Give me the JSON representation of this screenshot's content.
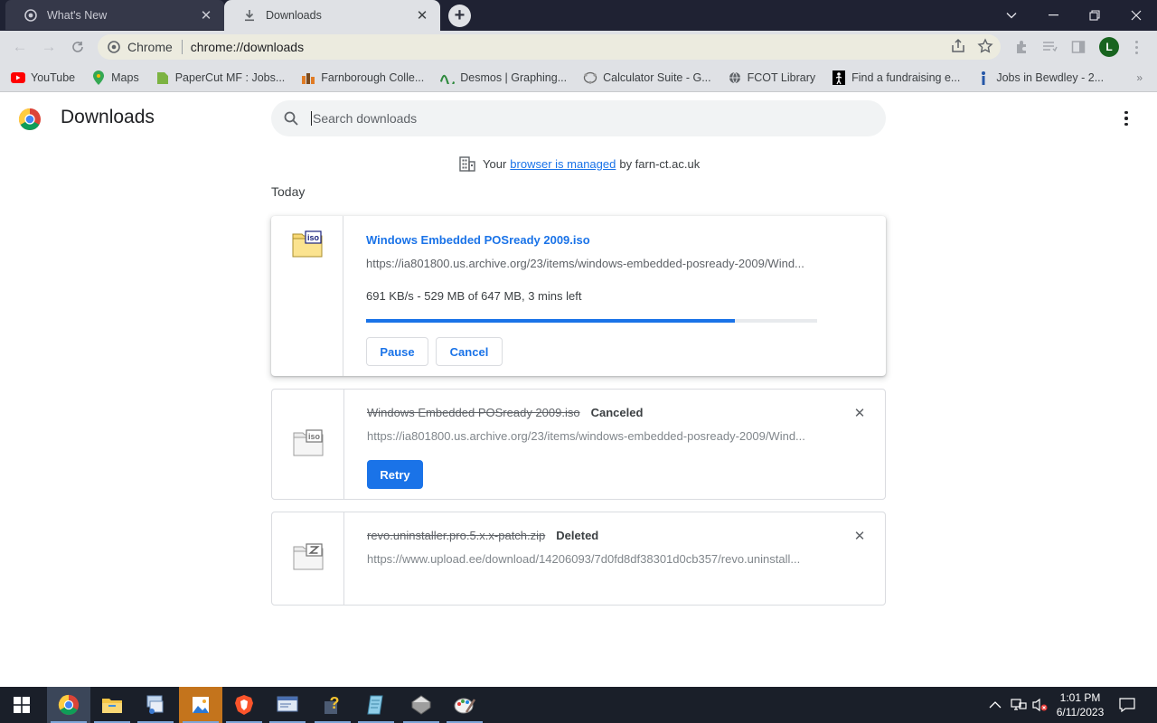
{
  "tabs": [
    {
      "title": "What's New",
      "icon": "chrome-settings-icon",
      "active": false
    },
    {
      "title": "Downloads",
      "icon": "download-icon",
      "active": true
    }
  ],
  "toolbar": {
    "site_chip": "Chrome",
    "url": "chrome://downloads",
    "avatar_letter": "L"
  },
  "bookmarks": [
    {
      "label": "YouTube",
      "icon": "youtube-icon",
      "color": "#ff0000"
    },
    {
      "label": "Maps",
      "icon": "maps-icon",
      "color": "#34a853"
    },
    {
      "label": "PaperCut MF : Jobs...",
      "icon": "papercut-icon",
      "color": "#7cb342"
    },
    {
      "label": "Farnborough Colle...",
      "icon": "college-icon",
      "color": "#e07b24"
    },
    {
      "label": "Desmos | Graphing...",
      "icon": "desmos-icon",
      "color": "#2f8a3e"
    },
    {
      "label": "Calculator Suite - G...",
      "icon": "geogebra-icon",
      "color": "#666666"
    },
    {
      "label": "FCOT Library",
      "icon": "globe-icon",
      "color": "#5f6368"
    },
    {
      "label": "Find a fundraising e...",
      "icon": "fundraising-icon",
      "color": "#000000"
    },
    {
      "label": "Jobs in Bewdley - 2...",
      "icon": "indeed-icon",
      "color": "#2557a7"
    }
  ],
  "page": {
    "title": "Downloads",
    "search_placeholder": "Search downloads",
    "managed_prefix": "Your",
    "managed_link": "browser is managed",
    "managed_suffix": "by farn-ct.ac.uk",
    "section": "Today"
  },
  "downloads": [
    {
      "name": "Windows Embedded POSready 2009.iso",
      "url": "https://ia801800.us.archive.org/23/items/windows-embedded-posready-2009/Wind...",
      "progress_text": "691 KB/s - 529 MB of 647 MB, 3 mins left",
      "progress": 0.8176,
      "buttons": [
        "Pause",
        "Cancel"
      ],
      "icon": "iso-file-icon"
    },
    {
      "name": "Windows Embedded POSready 2009.iso",
      "status": "Canceled",
      "url": "https://ia801800.us.archive.org/23/items/windows-embedded-posready-2009/Wind...",
      "button": "Retry",
      "icon": "iso-file-icon"
    },
    {
      "name": "revo.uninstaller.pro.5.x.x-patch.zip",
      "status": "Deleted",
      "url": "https://www.upload.ee/download/14206093/7d0fd8df38301d0cb357/revo.uninstall...",
      "icon": "zip-file-icon"
    }
  ],
  "taskbar": {
    "apps": [
      "start-icon",
      "chrome-icon",
      "file-explorer-icon",
      "network-manager-icon",
      "photos-icon",
      "brave-icon",
      "control-panel-icon",
      "help-icon",
      "notepad-icon",
      "tool-icon",
      "paint-icon"
    ],
    "time": "1:01 PM",
    "date": "6/11/2023"
  },
  "colors": {
    "accent": "#1a73e8",
    "tabstrip": "#1f2233",
    "toolbar": "#dfe1e5",
    "taskbar": "#1a1f29"
  }
}
